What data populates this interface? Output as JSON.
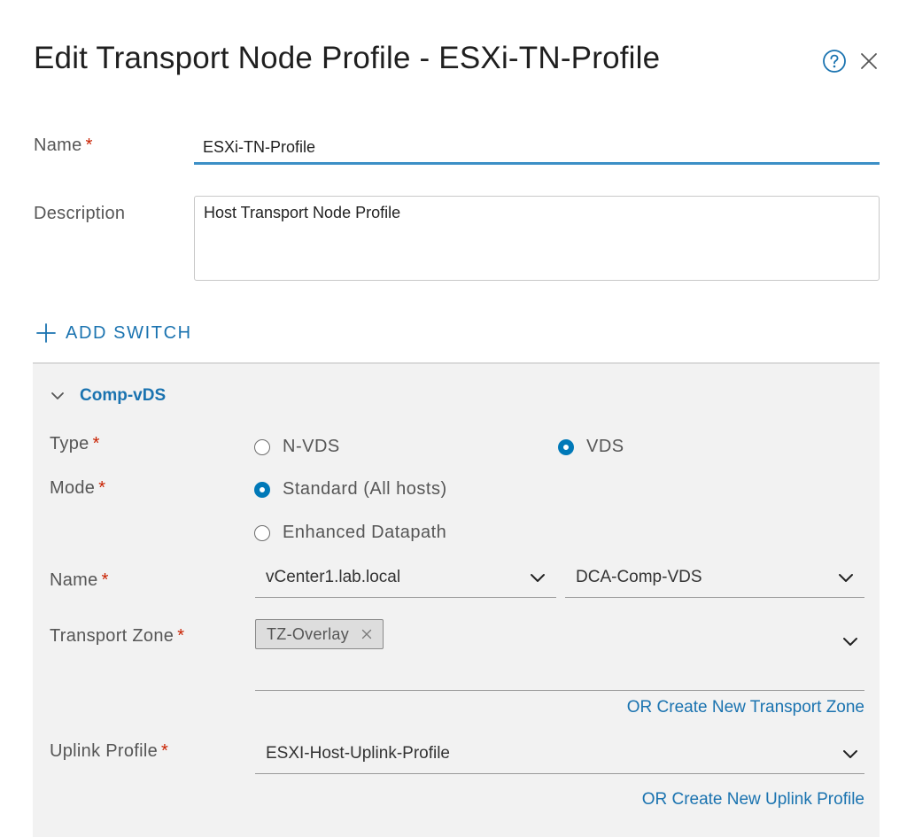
{
  "dialog": {
    "title": "Edit Transport Node Profile - ESXi-TN-Profile",
    "help_icon": "help-circle-icon",
    "close_icon": "close-icon"
  },
  "form": {
    "name": {
      "label": "Name",
      "required": "*",
      "value": "ESXi-TN-Profile"
    },
    "description": {
      "label": "Description",
      "value": "Host Transport Node Profile"
    }
  },
  "add_switch": {
    "label": "ADD SWITCH",
    "icon": "plus-icon"
  },
  "switch": {
    "name": "Comp-vDS",
    "type": {
      "label": "Type",
      "required": "*",
      "options": [
        {
          "label": "N-VDS",
          "checked": false
        },
        {
          "label": "VDS",
          "checked": true
        }
      ]
    },
    "mode": {
      "label": "Mode",
      "required": "*",
      "options": [
        {
          "label": "Standard (All hosts)",
          "checked": true
        },
        {
          "label": "Enhanced Datapath",
          "checked": false
        }
      ]
    },
    "name_field": {
      "label": "Name",
      "required": "*",
      "vcenter": "vCenter1.lab.local",
      "vds": "DCA-Comp-VDS"
    },
    "transport_zone": {
      "label": "Transport Zone",
      "required": "*",
      "tags": [
        "TZ-Overlay"
      ],
      "create_link": "OR Create New Transport Zone"
    },
    "uplink_profile": {
      "label": "Uplink Profile",
      "required": "*",
      "value": "ESXI-Host-Uplink-Profile",
      "create_link": "OR Create New Uplink Profile"
    }
  },
  "colors": {
    "accent": "#1a73b0",
    "required": "#c92100",
    "panel_bg": "#f2f2f2",
    "focus_underline": "#3c8fc6"
  }
}
